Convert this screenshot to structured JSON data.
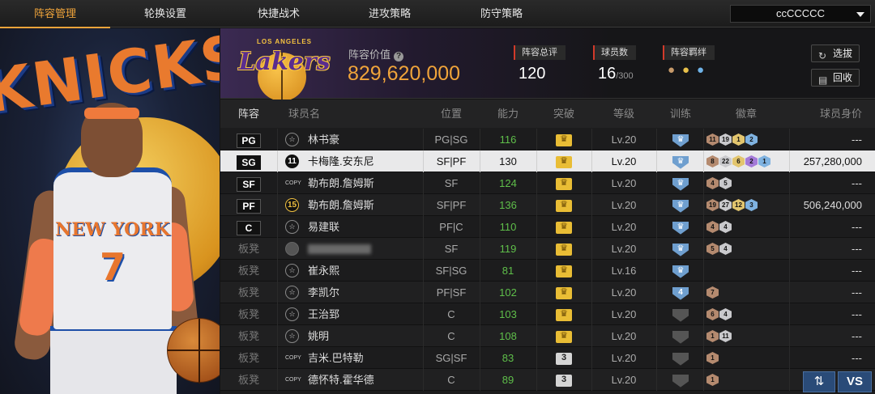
{
  "tabs": [
    "阵容管理",
    "轮换设置",
    "快捷战术",
    "进攻策略",
    "防守策略"
  ],
  "team_select": {
    "value": "ccCCCCC"
  },
  "player_art": {
    "team_word": "KNICKS",
    "jersey_text": "NEW YORK",
    "jersey_number": "7"
  },
  "header": {
    "logo_top": "LOS ANGELES",
    "logo_text": "Lakers",
    "value_label": "阵容价值",
    "value": "829,620,000",
    "overall_label": "阵容总评",
    "overall_value": "120",
    "count_label": "球员数",
    "count_value": "16",
    "count_max": "/300",
    "bond_label": "阵容羁绊",
    "select_button": "选拔",
    "recycle_button": "回收"
  },
  "columns": [
    "阵容",
    "球员名",
    "位置",
    "能力",
    "突破",
    "等级",
    "训练",
    "徽章",
    "球员身价"
  ],
  "rows": [
    {
      "slot": "PG",
      "icon": "star",
      "name": "林书豪",
      "pos": "PG|SG",
      "rating": "116",
      "break": "crown",
      "level": "Lv.20",
      "train": "",
      "badges": [
        [
          "bronze",
          "11"
        ],
        [
          "silver",
          "19"
        ],
        [
          "gold",
          "1"
        ],
        [
          "blue",
          "2"
        ]
      ],
      "worth": "---"
    },
    {
      "slot": "SG",
      "icon": "num",
      "icon_text": "11",
      "name": "卡梅隆.安东尼",
      "pos": "SF|PF",
      "rating": "130",
      "break": "crown",
      "level": "Lv.20",
      "train": "",
      "badges": [
        [
          "bronze",
          "8"
        ],
        [
          "silver",
          "22"
        ],
        [
          "gold",
          "6"
        ],
        [
          "purple",
          "2"
        ],
        [
          "blue",
          "1"
        ]
      ],
      "worth": "257,280,000"
    },
    {
      "slot": "SF",
      "icon": "copy",
      "name": "勒布朗.詹姆斯",
      "pos": "SF",
      "rating": "124",
      "break": "crown",
      "level": "Lv.20",
      "train": "",
      "badges": [
        [
          "bronze",
          "4"
        ],
        [
          "silver",
          "5"
        ]
      ],
      "worth": "---"
    },
    {
      "slot": "PF",
      "icon": "num",
      "icon_text": "15",
      "name": "勒布朗.詹姆斯",
      "pos": "SF|PF",
      "rating": "136",
      "break": "crown",
      "level": "Lv.20",
      "train": "",
      "badges": [
        [
          "bronze",
          "19"
        ],
        [
          "silver",
          "27"
        ],
        [
          "gold",
          "12"
        ],
        [
          "blue",
          "3"
        ]
      ],
      "worth": "506,240,000"
    },
    {
      "slot": "C",
      "icon": "star",
      "name": "易建联",
      "pos": "PF|C",
      "rating": "110",
      "break": "crown",
      "level": "Lv.20",
      "train": "",
      "badges": [
        [
          "bronze",
          "4"
        ],
        [
          "silver",
          "4"
        ]
      ],
      "worth": "---"
    },
    {
      "slot": "板凳",
      "icon": "anon",
      "name": "",
      "pos": "SF",
      "rating": "119",
      "break": "crown",
      "level": "Lv.20",
      "train": "",
      "badges": [
        [
          "bronze",
          "5"
        ],
        [
          "silver",
          "4"
        ]
      ],
      "worth": "---"
    },
    {
      "slot": "板凳",
      "icon": "star",
      "name": "崔永熙",
      "pos": "SF|SG",
      "rating": "81",
      "break": "crown",
      "level": "Lv.16",
      "train": "",
      "badges": [],
      "worth": "---"
    },
    {
      "slot": "板凳",
      "icon": "star",
      "name": "李凯尔",
      "pos": "PF|SF",
      "rating": "102",
      "break": "crown",
      "level": "Lv.20",
      "train": "4",
      "badges": [
        [
          "bronze",
          "7"
        ]
      ],
      "worth": "---"
    },
    {
      "slot": "板凳",
      "icon": "star",
      "name": "王治郅",
      "pos": "C",
      "rating": "103",
      "break": "crown",
      "level": "Lv.20",
      "train": "dark",
      "badges": [
        [
          "bronze",
          "6"
        ],
        [
          "silver",
          "4"
        ]
      ],
      "worth": "---"
    },
    {
      "slot": "板凳",
      "icon": "star",
      "name": "姚明",
      "pos": "C",
      "rating": "108",
      "break": "crown",
      "level": "Lv.20",
      "train": "dark",
      "badges": [
        [
          "bronze",
          "1"
        ],
        [
          "silver",
          "11"
        ]
      ],
      "worth": "---"
    },
    {
      "slot": "板凳",
      "icon": "copy",
      "name": "吉米.巴特勒",
      "pos": "SG|SF",
      "rating": "83",
      "break": "3",
      "level": "Lv.20",
      "train": "dark",
      "badges": [
        [
          "bronze",
          "1"
        ]
      ],
      "worth": "---"
    },
    {
      "slot": "板凳",
      "icon": "copy",
      "name": "德怀特.霍华德",
      "pos": "C",
      "rating": "89",
      "break": "3",
      "level": "Lv.20",
      "train": "dark",
      "badges": [
        [
          "bronze",
          "1"
        ]
      ],
      "worth": ""
    }
  ],
  "copy_text": "COPY",
  "swap_icon": "swap-arrows-icon",
  "vs_button": "VS"
}
